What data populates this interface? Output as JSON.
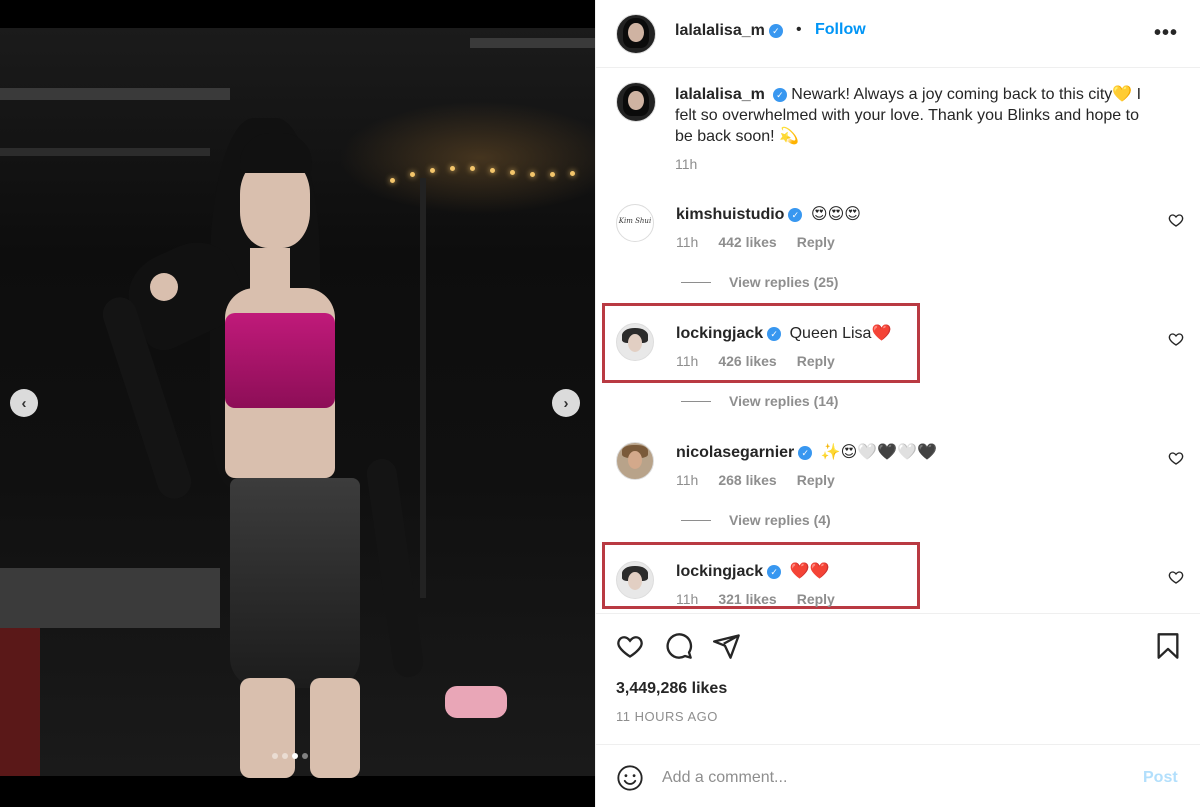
{
  "post": {
    "username": "lalalalisa_m",
    "follow_label": "Follow",
    "more_label": "•••",
    "caption_text": "Newark! Always a joy coming back to this city💛 I felt so overwhelmed with your love. Thank you Blinks and hope to be back soon! 💫",
    "caption_time": "11h",
    "likes_text": "3,449,286 likes",
    "time_ago": "11 HOURS AGO"
  },
  "comments": [
    {
      "username": "kimshuistudio",
      "text": "😍😍😍",
      "time": "11h",
      "likes": "442 likes",
      "reply_label": "Reply",
      "view_replies": "View replies (25)",
      "avatar_text": "Kim Shui"
    },
    {
      "username": "lockingjack",
      "text": "Queen Lisa❤️",
      "time": "11h",
      "likes": "426 likes",
      "reply_label": "Reply",
      "view_replies": "View replies (14)"
    },
    {
      "username": "nicolasegarnier",
      "text": "✨😍🤍🖤🤍🖤",
      "time": "11h",
      "likes": "268 likes",
      "reply_label": "Reply",
      "view_replies": "View replies (4)"
    },
    {
      "username": "lockingjack",
      "text": "❤️❤️",
      "time": "11h",
      "likes": "321 likes",
      "reply_label": "Reply"
    }
  ],
  "composer": {
    "placeholder": "Add a comment...",
    "post_label": "Post"
  },
  "carousel": {
    "prev": "‹",
    "next": "›",
    "slide_count": 4,
    "active_slide": 3
  },
  "colors": {
    "accent": "#0095f6",
    "verified": "#3897f0",
    "highlight": "#b93a42",
    "muted": "#8e8e8e"
  },
  "icons": [
    "heart-icon",
    "comment-icon",
    "share-icon",
    "bookmark-icon",
    "emoji-icon",
    "more-icon",
    "chevron-left-icon",
    "chevron-right-icon",
    "verified-icon"
  ]
}
